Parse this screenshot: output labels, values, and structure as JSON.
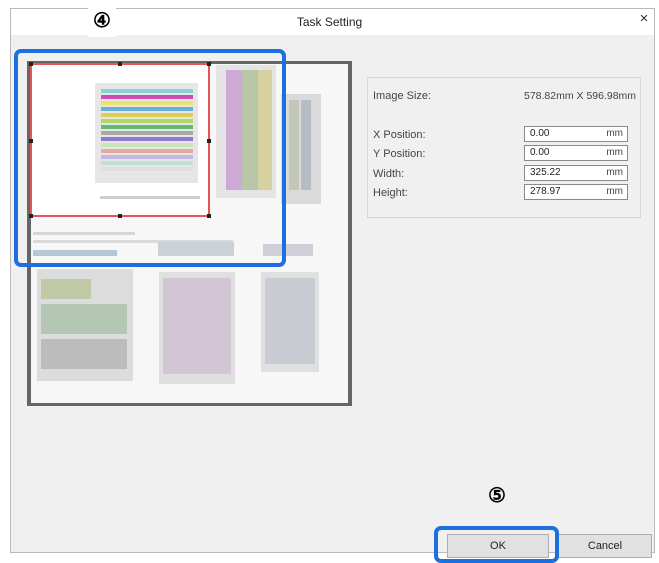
{
  "dialog": {
    "title": "Task Setting",
    "close_glyph": "×"
  },
  "markers": {
    "step4": "④",
    "step5": "⑤"
  },
  "image_size": {
    "label": "Image Size:",
    "value": "578.82mm X 596.98mm"
  },
  "fields": [
    {
      "label": "X Position:",
      "value": "0.00",
      "unit": "mm"
    },
    {
      "label": "Y Position:",
      "value": "0.00",
      "unit": "mm"
    },
    {
      "label": "Width:",
      "value": "325.22",
      "unit": "mm"
    },
    {
      "label": "Height:",
      "value": "278.97",
      "unit": "mm"
    }
  ],
  "buttons": {
    "ok": "OK",
    "cancel": "Cancel"
  },
  "colors": {
    "highlight": "#1b6fe0",
    "crop_border": "#e65555",
    "preview_frame": "#666666"
  }
}
